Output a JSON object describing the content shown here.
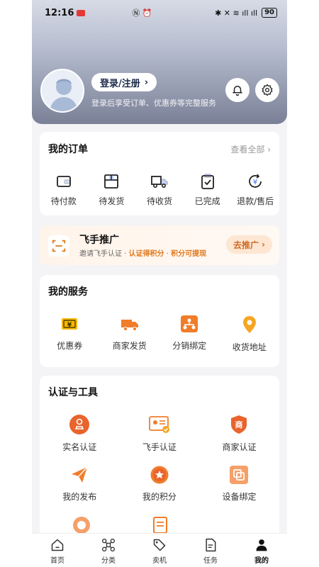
{
  "status": {
    "time": "12:16",
    "battery": "90"
  },
  "profile": {
    "login_label": "登录/注册",
    "login_sub": "登录后享受订单、优惠券等完整服务"
  },
  "orders": {
    "title": "我的订单",
    "see_all": "查看全部",
    "items": [
      {
        "label": "待付款",
        "icon": "wallet-icon"
      },
      {
        "label": "待发货",
        "icon": "package-icon"
      },
      {
        "label": "待收货",
        "icon": "truck-icon"
      },
      {
        "label": "已完成",
        "icon": "clipboard-check-icon"
      },
      {
        "label": "退款/售后",
        "icon": "refund-icon"
      }
    ]
  },
  "promo": {
    "title": "飞手推广",
    "sub_prefix": "邀请飞手认证 · ",
    "sub_hi1": "认证得积分",
    "sub_sep": " · ",
    "sub_hi2": "积分可提现",
    "button": "去推广"
  },
  "services": {
    "title": "我的服务",
    "items": [
      {
        "label": "优惠券",
        "icon": "coupon-icon"
      },
      {
        "label": "商家发货",
        "icon": "delivery-truck-icon"
      },
      {
        "label": "分销绑定",
        "icon": "distribution-icon"
      },
      {
        "label": "收货地址",
        "icon": "location-pin-icon"
      }
    ]
  },
  "tools": {
    "title": "认证与工具",
    "items": [
      {
        "label": "实名认证",
        "icon": "stamp-icon"
      },
      {
        "label": "飞手认证",
        "icon": "id-card-icon"
      },
      {
        "label": "商家认证",
        "icon": "shop-badge-icon"
      },
      {
        "label": "我的发布",
        "icon": "paper-plane-icon"
      },
      {
        "label": "我的积分",
        "icon": "star-points-icon"
      },
      {
        "label": "设备绑定",
        "icon": "device-bind-icon"
      }
    ]
  },
  "tabbar": {
    "items": [
      {
        "label": "首页",
        "icon": "home-icon"
      },
      {
        "label": "分类",
        "icon": "drone-icon"
      },
      {
        "label": "卖机",
        "icon": "tag-icon"
      },
      {
        "label": "任务",
        "icon": "task-doc-icon"
      },
      {
        "label": "我的",
        "icon": "user-icon"
      }
    ]
  },
  "colors": {
    "accent": "#f07d2a",
    "header_bottom": "#7a8096"
  }
}
